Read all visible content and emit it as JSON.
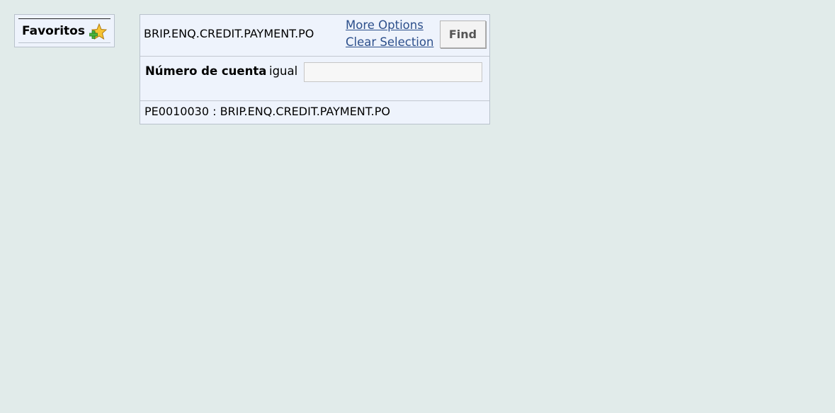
{
  "favorites": {
    "label": "Favoritos",
    "icon": "add-favorite-star-icon"
  },
  "enquiry": {
    "name": "BRIP.ENQ.CREDIT.PAYMENT.PO",
    "more_options": "More Options",
    "clear_selection": "Clear Selection",
    "find_label": "Find"
  },
  "criteria": [
    {
      "field": "Número de cuenta",
      "operator": "igual",
      "value": ""
    }
  ],
  "footer": {
    "text": "PE0010030 : BRIP.ENQ.CREDIT.PAYMENT.PO"
  },
  "colors": {
    "background": "#e1ebea",
    "panel": "#eef3fc",
    "link": "#2c4f8b"
  }
}
